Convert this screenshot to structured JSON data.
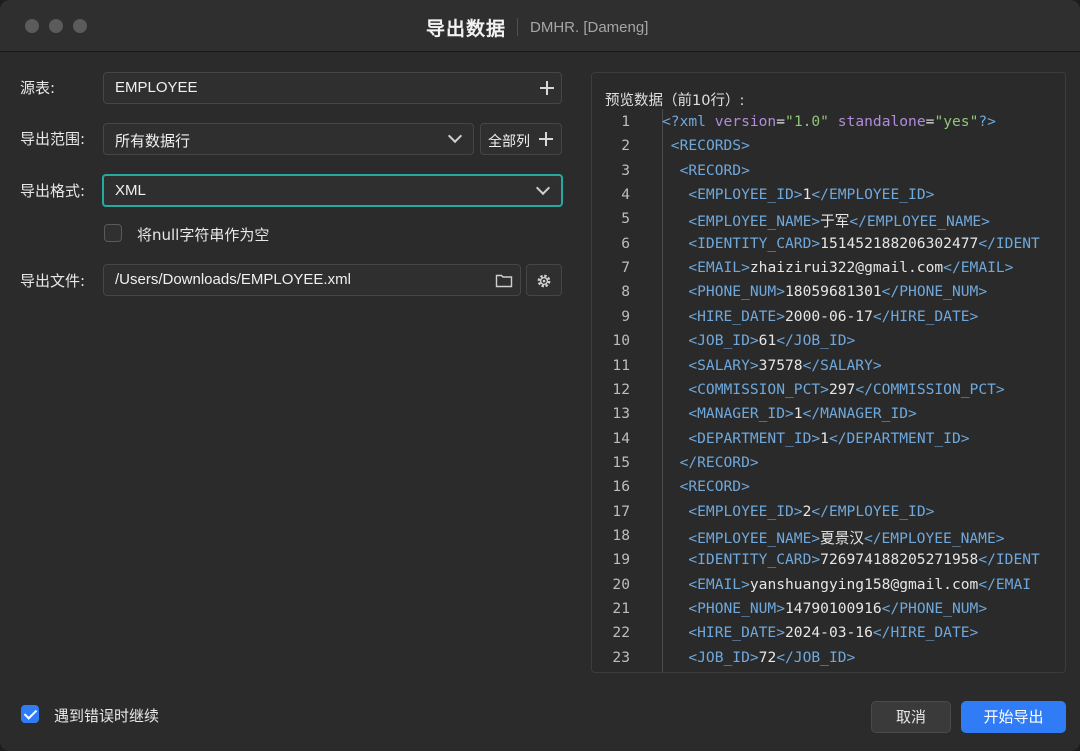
{
  "titlebar": {
    "title": "导出数据",
    "subtitle": "DMHR. [Dameng]"
  },
  "form": {
    "source_label": "源表:",
    "source_value": "EMPLOYEE",
    "range_label": "导出范围:",
    "range_value": "所有数据行",
    "all_columns_label": "全部列",
    "format_label": "导出格式:",
    "format_value": "XML",
    "null_checkbox_label": "将null字符串作为空",
    "null_checkbox_checked": false,
    "file_label": "导出文件:",
    "file_value": "/Users/Downloads/EMPLOYEE.xml"
  },
  "preview": {
    "title": "预览数据（前10行）:",
    "lines": [
      {
        "n": "1",
        "indent": "",
        "parts": [
          [
            "tag",
            "<?xml "
          ],
          [
            "attr",
            "version"
          ],
          [
            "txt",
            "="
          ],
          [
            "val",
            "\"1.0\""
          ],
          [
            "txt",
            " "
          ],
          [
            "attr",
            "standalone"
          ],
          [
            "txt",
            "="
          ],
          [
            "val",
            "\"yes\""
          ],
          [
            "tag",
            "?>"
          ]
        ]
      },
      {
        "n": "2",
        "indent": " ",
        "parts": [
          [
            "tag",
            "<RECORDS>"
          ]
        ]
      },
      {
        "n": "3",
        "indent": "  ",
        "parts": [
          [
            "tag",
            "<RECORD>"
          ]
        ]
      },
      {
        "n": "4",
        "indent": "   ",
        "parts": [
          [
            "tag",
            "<EMPLOYEE_ID>"
          ],
          [
            "txt",
            "1"
          ],
          [
            "tag",
            "</EMPLOYEE_ID>"
          ]
        ]
      },
      {
        "n": "5",
        "indent": "   ",
        "parts": [
          [
            "tag",
            "<EMPLOYEE_NAME>"
          ],
          [
            "txt",
            "于军"
          ],
          [
            "tag",
            "</EMPLOYEE_NAME>"
          ]
        ]
      },
      {
        "n": "6",
        "indent": "   ",
        "parts": [
          [
            "tag",
            "<IDENTITY_CARD>"
          ],
          [
            "txt",
            "151452188206302477"
          ],
          [
            "tag",
            "</IDENT"
          ]
        ]
      },
      {
        "n": "7",
        "indent": "   ",
        "parts": [
          [
            "tag",
            "<EMAIL>"
          ],
          [
            "txt",
            "zhaizirui322@gmail.com"
          ],
          [
            "tag",
            "</EMAIL>"
          ]
        ]
      },
      {
        "n": "8",
        "indent": "   ",
        "parts": [
          [
            "tag",
            "<PHONE_NUM>"
          ],
          [
            "txt",
            "18059681301"
          ],
          [
            "tag",
            "</PHONE_NUM>"
          ]
        ]
      },
      {
        "n": "9",
        "indent": "   ",
        "parts": [
          [
            "tag",
            "<HIRE_DATE>"
          ],
          [
            "txt",
            "2000-06-17"
          ],
          [
            "tag",
            "</HIRE_DATE>"
          ]
        ]
      },
      {
        "n": "10",
        "indent": "   ",
        "parts": [
          [
            "tag",
            "<JOB_ID>"
          ],
          [
            "txt",
            "61"
          ],
          [
            "tag",
            "</JOB_ID>"
          ]
        ]
      },
      {
        "n": "11",
        "indent": "   ",
        "parts": [
          [
            "tag",
            "<SALARY>"
          ],
          [
            "txt",
            "37578"
          ],
          [
            "tag",
            "</SALARY>"
          ]
        ]
      },
      {
        "n": "12",
        "indent": "   ",
        "parts": [
          [
            "tag",
            "<COMMISSION_PCT>"
          ],
          [
            "txt",
            "297"
          ],
          [
            "tag",
            "</COMMISSION_PCT>"
          ]
        ]
      },
      {
        "n": "13",
        "indent": "   ",
        "parts": [
          [
            "tag",
            "<MANAGER_ID>"
          ],
          [
            "txt",
            "1"
          ],
          [
            "tag",
            "</MANAGER_ID>"
          ]
        ]
      },
      {
        "n": "14",
        "indent": "   ",
        "parts": [
          [
            "tag",
            "<DEPARTMENT_ID>"
          ],
          [
            "txt",
            "1"
          ],
          [
            "tag",
            "</DEPARTMENT_ID>"
          ]
        ]
      },
      {
        "n": "15",
        "indent": "  ",
        "parts": [
          [
            "tag",
            "</RECORD>"
          ]
        ]
      },
      {
        "n": "16",
        "indent": "  ",
        "parts": [
          [
            "tag",
            "<RECORD>"
          ]
        ]
      },
      {
        "n": "17",
        "indent": "   ",
        "parts": [
          [
            "tag",
            "<EMPLOYEE_ID>"
          ],
          [
            "txt",
            "2"
          ],
          [
            "tag",
            "</EMPLOYEE_ID>"
          ]
        ]
      },
      {
        "n": "18",
        "indent": "   ",
        "parts": [
          [
            "tag",
            "<EMPLOYEE_NAME>"
          ],
          [
            "txt",
            "夏景汉"
          ],
          [
            "tag",
            "</EMPLOYEE_NAME>"
          ]
        ]
      },
      {
        "n": "19",
        "indent": "   ",
        "parts": [
          [
            "tag",
            "<IDENTITY_CARD>"
          ],
          [
            "txt",
            "726974188205271958"
          ],
          [
            "tag",
            "</IDENT"
          ]
        ]
      },
      {
        "n": "20",
        "indent": "   ",
        "parts": [
          [
            "tag",
            "<EMAIL>"
          ],
          [
            "txt",
            "yanshuangying158@gmail.com"
          ],
          [
            "tag",
            "</EMAI"
          ]
        ]
      },
      {
        "n": "21",
        "indent": "   ",
        "parts": [
          [
            "tag",
            "<PHONE_NUM>"
          ],
          [
            "txt",
            "14790100916"
          ],
          [
            "tag",
            "</PHONE_NUM>"
          ]
        ]
      },
      {
        "n": "22",
        "indent": "   ",
        "parts": [
          [
            "tag",
            "<HIRE_DATE>"
          ],
          [
            "txt",
            "2024-03-16"
          ],
          [
            "tag",
            "</HIRE_DATE>"
          ]
        ]
      },
      {
        "n": "23",
        "indent": "   ",
        "parts": [
          [
            "tag",
            "<JOB_ID>"
          ],
          [
            "txt",
            "72"
          ],
          [
            "tag",
            "</JOB_ID>"
          ]
        ]
      }
    ]
  },
  "footer": {
    "continue_on_error_label": "遇到错误时继续",
    "continue_on_error_checked": true,
    "cancel_label": "取消",
    "start_label": "开始导出"
  },
  "colors": {
    "accent": "#2f7cf6",
    "focus": "#27a8a0",
    "tag": "#6fa8dc",
    "attr": "#b48ade",
    "value": "#8fc67a"
  }
}
